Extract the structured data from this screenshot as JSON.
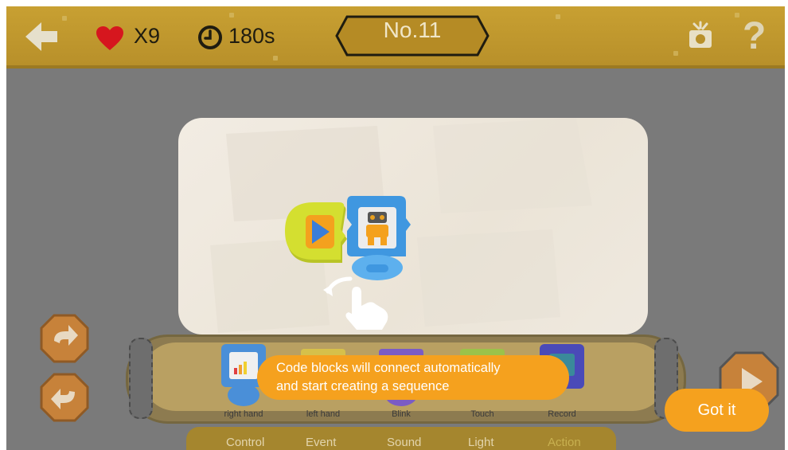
{
  "header": {
    "lives": "X9",
    "timer": "180s",
    "level": "No.11",
    "help": "?"
  },
  "tutorial": {
    "line1": "Code blocks will connect automatically",
    "line2": "and start creating a sequence",
    "confirm": "Got it"
  },
  "tray": {
    "blocks": [
      {
        "label": "right hand",
        "color": "#4a8fd8"
      },
      {
        "label": "left hand",
        "color": "#d6c04a"
      },
      {
        "label": "Blink",
        "color": "#7b5cc4"
      },
      {
        "label": "Touch",
        "color": "#9bc24a"
      },
      {
        "label": "Record",
        "color": "#4a4ab8"
      }
    ]
  },
  "tabs": [
    "Control",
    "Event",
    "Sound",
    "Light",
    "Action"
  ],
  "colors": {
    "accent": "#f5a11e",
    "topbar": "#c8a032",
    "heart": "#d6161e",
    "start_block": "#c9d82c",
    "robot_block": "#4aa8ea"
  },
  "icons": [
    "back-arrow-icon",
    "heart-icon",
    "clock-icon",
    "photo-icon",
    "help-icon",
    "redo-icon",
    "undo-icon",
    "play-icon",
    "hand-pointer-icon"
  ]
}
